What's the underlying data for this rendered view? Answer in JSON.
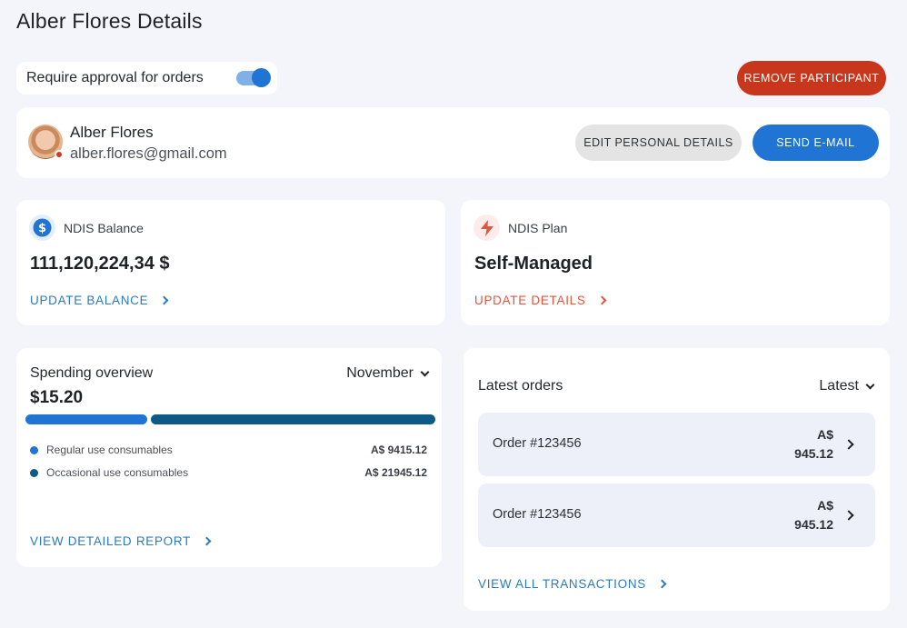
{
  "page": {
    "title": "Alber Flores Details"
  },
  "approval": {
    "label": "Require approval for orders",
    "enabled": true
  },
  "actions": {
    "remove_label": "REMOVE PARTICIPANT"
  },
  "profile": {
    "name": "Alber Flores",
    "email": "alber.flores@gmail.com",
    "status_color": "#d4391f",
    "edit_label": "EDIT PERSONAL DETAILS",
    "email_label": "SEND E-MAIL"
  },
  "balance": {
    "label": "NDIS Balance",
    "value": "111,120,224,34 $",
    "link": "UPDATE BALANCE",
    "icon": "dollar-icon",
    "color": "#1f74d4"
  },
  "plan": {
    "label": "NDIS Plan",
    "value": "Self-Managed",
    "link": "UPDATE DETAILS",
    "icon": "lightning-icon",
    "color": "#e0553f"
  },
  "spending": {
    "title": "Spending overview",
    "month": "November",
    "total": "$15.20",
    "categories": [
      {
        "label": "Regular use consumables",
        "amount": "A$ 9415.12",
        "color": "#1f74d4",
        "share": 0.3
      },
      {
        "label": "Occasional use consumables",
        "amount": "A$ 21945.12",
        "color": "#0e5a86",
        "share": 0.7
      }
    ],
    "link": "VIEW DETAILED REPORT"
  },
  "orders": {
    "title": "Latest orders",
    "sort": "Latest",
    "items": [
      {
        "id": "Order #123456",
        "currency": "A$",
        "amount": "945.12"
      },
      {
        "id": "Order #123456",
        "currency": "A$",
        "amount": "945.12"
      }
    ],
    "link": "VIEW ALL TRANSACTIONS"
  },
  "colors": {
    "accent": "#1f74d4",
    "danger": "#c8361c",
    "link_blue": "#2a7bbf",
    "link_red": "#e0553f",
    "background": "#f4f5fb"
  }
}
